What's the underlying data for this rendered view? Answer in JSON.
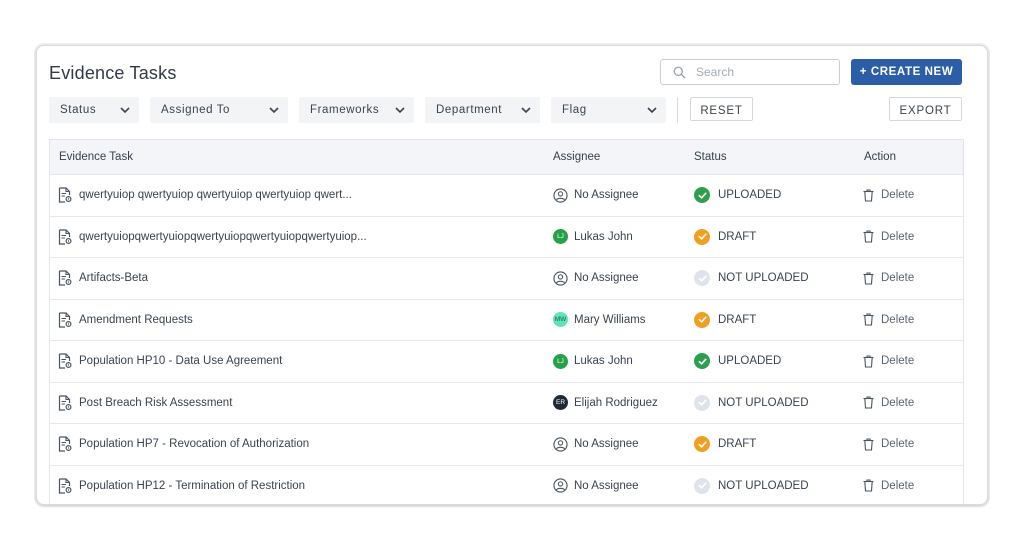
{
  "header": {
    "title": "Evidence Tasks",
    "search_placeholder": "Search",
    "create_label": "+ CREATE NEW"
  },
  "filters": {
    "items": [
      "Status",
      "Assigned To",
      "Frameworks",
      "Department",
      "Flag"
    ],
    "reset_label": "RESET",
    "export_label": "EXPORT"
  },
  "table": {
    "columns": [
      "Evidence Task",
      "Assignee",
      "Status",
      "Action"
    ],
    "delete_label": "Delete",
    "rows": [
      {
        "task": "qwertyuiop qwertyuiop qwertyuiop qwertyuiop qwert...",
        "assignee": "No Assignee",
        "initials": "",
        "avatar_type": "none",
        "status": "UPLOADED",
        "status_type": "uploaded"
      },
      {
        "task": "qwertyuiopqwertyuiopqwertyuiopqwertyuiopqwertyuiop...",
        "assignee": "Lukas John",
        "initials": "LJ",
        "avatar_type": "green",
        "status": "DRAFT",
        "status_type": "draft"
      },
      {
        "task": "Artifacts-Beta",
        "assignee": "No Assignee",
        "initials": "",
        "avatar_type": "none",
        "status": "NOT UPLOADED",
        "status_type": "not_uploaded"
      },
      {
        "task": "Amendment Requests",
        "assignee": "Mary Williams",
        "initials": "MW",
        "avatar_type": "mint",
        "status": "DRAFT",
        "status_type": "draft"
      },
      {
        "task": "Population HP10 - Data Use Agreement",
        "assignee": "Lukas John",
        "initials": "LJ",
        "avatar_type": "green",
        "status": "UPLOADED",
        "status_type": "uploaded"
      },
      {
        "task": "Post Breach Risk Assessment",
        "assignee": "Elijah Rodriguez",
        "initials": "ER",
        "avatar_type": "dark",
        "status": "NOT UPLOADED",
        "status_type": "not_uploaded"
      },
      {
        "task": "Population HP7 - Revocation of Authorization",
        "assignee": "No Assignee",
        "initials": "",
        "avatar_type": "none",
        "status": "DRAFT",
        "status_type": "draft"
      },
      {
        "task": "Population HP12 - Termination of Restriction",
        "assignee": "No Assignee",
        "initials": "",
        "avatar_type": "none",
        "status": "NOT UPLOADED",
        "status_type": "not_uploaded"
      }
    ]
  },
  "colors": {
    "primary": "#2b5ea7",
    "uploaded": "#2e9e4f",
    "draft": "#f0a020",
    "not_uploaded": "#dfe4ea",
    "avatar_green": "#27a145",
    "avatar_mint": "#5fe3b8",
    "avatar_dark": "#1f2a37"
  },
  "icons": {
    "search": "search-icon",
    "chevron": "chevron-down-icon",
    "task": "document-gear-icon",
    "no_assignee": "user-circle-icon",
    "status_check": "check-icon",
    "delete": "trash-icon"
  }
}
